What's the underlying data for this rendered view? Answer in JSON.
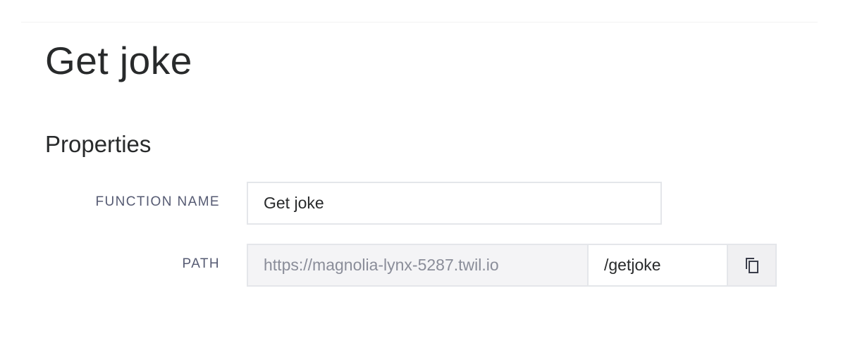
{
  "header": {
    "title": "Get joke"
  },
  "properties": {
    "section_title": "Properties",
    "function_name": {
      "label": "FUNCTION NAME",
      "value": "Get joke"
    },
    "path": {
      "label": "PATH",
      "base_url": "https://magnolia-lynx-5287.twil.io",
      "value": "/getjoke",
      "copy_icon": "copy-icon"
    }
  }
}
